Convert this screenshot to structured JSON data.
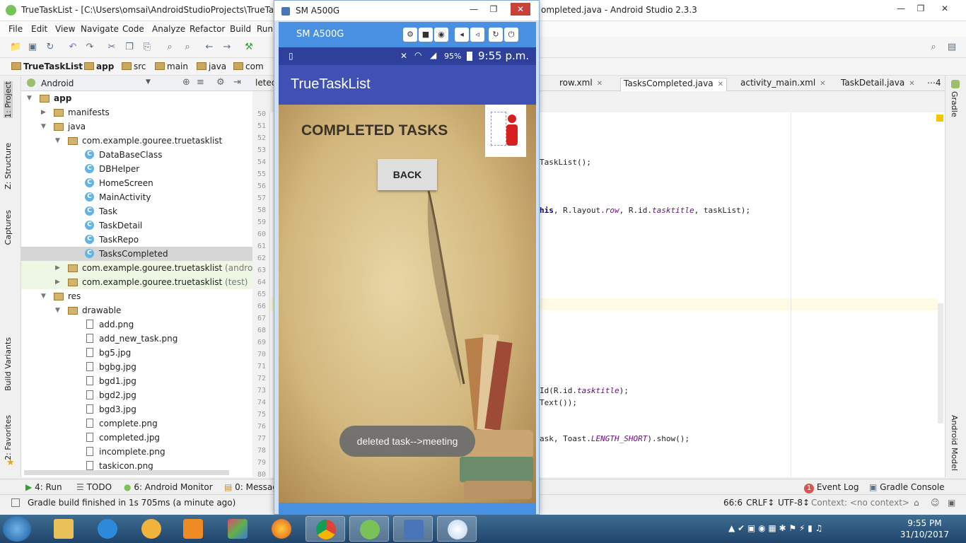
{
  "ide": {
    "title": "TrueTaskList - [C:\\Users\\omsai\\AndroidStudioProjects\\TrueTaskList]",
    "title_right": "ompleted.java - Android Studio 2.3.3",
    "menu": [
      "File",
      "Edit",
      "View",
      "Navigate",
      "Code",
      "Analyze",
      "Refactor",
      "Build",
      "Run"
    ],
    "breadcrumb": [
      "TrueTaskList",
      "app",
      "src",
      "main",
      "java",
      "com"
    ],
    "project_view": "Android",
    "left_tabs": [
      "1: Project",
      "Z: Structure",
      "Captures",
      "Build Variants",
      "2: Favorites"
    ],
    "right_tabs": [
      "Gradle",
      "Android Model"
    ],
    "tree": [
      {
        "label": "app",
        "depth": 0,
        "kind": "module",
        "open": true,
        "bold": true
      },
      {
        "label": "manifests",
        "depth": 1,
        "kind": "folder",
        "open": false
      },
      {
        "label": "java",
        "depth": 1,
        "kind": "folder",
        "open": true
      },
      {
        "label": "com.example.gouree.truetasklist",
        "depth": 2,
        "kind": "package",
        "open": true
      },
      {
        "label": "DataBaseClass",
        "depth": 3,
        "kind": "class"
      },
      {
        "label": "DBHelper",
        "depth": 3,
        "kind": "class"
      },
      {
        "label": "HomeScreen",
        "depth": 3,
        "kind": "class"
      },
      {
        "label": "MainActivity",
        "depth": 3,
        "kind": "class"
      },
      {
        "label": "Task",
        "depth": 3,
        "kind": "class"
      },
      {
        "label": "TaskDetail",
        "depth": 3,
        "kind": "class"
      },
      {
        "label": "TaskRepo",
        "depth": 3,
        "kind": "class"
      },
      {
        "label": "TasksCompleted",
        "depth": 3,
        "kind": "class",
        "selected": true
      },
      {
        "label": "com.example.gouree.truetasklist",
        "suffix": "(androidTest)",
        "depth": 2,
        "kind": "package",
        "open": false,
        "test": true
      },
      {
        "label": "com.example.gouree.truetasklist",
        "suffix": "(test)",
        "depth": 2,
        "kind": "package",
        "open": false,
        "test": true
      },
      {
        "label": "res",
        "depth": 1,
        "kind": "folder",
        "open": true
      },
      {
        "label": "drawable",
        "depth": 2,
        "kind": "folder",
        "open": true
      },
      {
        "label": "add.png",
        "depth": 3,
        "kind": "image"
      },
      {
        "label": "add_new_task.png",
        "depth": 3,
        "kind": "image"
      },
      {
        "label": "bg5.jpg",
        "depth": 3,
        "kind": "image"
      },
      {
        "label": "bgbg.jpg",
        "depth": 3,
        "kind": "image"
      },
      {
        "label": "bgd1.jpg",
        "depth": 3,
        "kind": "image"
      },
      {
        "label": "bgd2.jpg",
        "depth": 3,
        "kind": "image"
      },
      {
        "label": "bgd3.jpg",
        "depth": 3,
        "kind": "image"
      },
      {
        "label": "complete.png",
        "depth": 3,
        "kind": "image"
      },
      {
        "label": "completed.jpg",
        "depth": 3,
        "kind": "image"
      },
      {
        "label": "incomplete.png",
        "depth": 3,
        "kind": "image"
      },
      {
        "label": "taskicon.png",
        "depth": 3,
        "kind": "image"
      }
    ],
    "editor_tabs": [
      {
        "label": "leted.",
        "active": false
      },
      {
        "label": "row.xml",
        "active": false
      },
      {
        "label": "TasksCompleted.java",
        "active": true
      },
      {
        "label": "activity_main.xml",
        "active": false
      },
      {
        "label": "TaskDetail.java",
        "active": false
      },
      {
        "label": "⋯4",
        "active": false
      }
    ],
    "line_numbers": [
      "50",
      "51",
      "52",
      "53",
      "54",
      "55",
      "56",
      "57",
      "58",
      "59",
      "60",
      "61",
      "62",
      "63",
      "64",
      "65",
      "66",
      "67",
      "68",
      "69",
      "70",
      "71",
      "72",
      "73",
      "74",
      "75",
      "76",
      "77",
      "78",
      "79",
      "80"
    ],
    "code": [
      {
        "line": 54,
        "parts": [
          {
            "t": "TaskList();"
          }
        ]
      },
      {
        "line": 58,
        "parts": [
          {
            "t": "his",
            "cls": "code-b"
          },
          {
            "t": ", R.layout."
          },
          {
            "t": "row",
            "cls": "code-it"
          },
          {
            "t": ", R.id."
          },
          {
            "t": "tasktitle",
            "cls": "code-it"
          },
          {
            "t": ", taskList);"
          }
        ]
      },
      {
        "line": 73,
        "parts": [
          {
            "t": "Id(R.id."
          },
          {
            "t": "tasktitle",
            "cls": "code-it"
          },
          {
            "t": ");"
          }
        ]
      },
      {
        "line": 74,
        "parts": [
          {
            "t": "Text());"
          }
        ]
      },
      {
        "line": 77,
        "parts": [
          {
            "t": "ask, Toast."
          },
          {
            "t": "LENGTH_SHORT",
            "cls": "code-it"
          },
          {
            "t": ").show();"
          }
        ]
      }
    ],
    "bottom_tabs": [
      "4: Run",
      "TODO",
      "6: Android Monitor",
      "0: Messag"
    ],
    "bottom_right_tabs": {
      "event_log": "Event Log",
      "event_count": "1",
      "gradle_console": "Gradle Console"
    },
    "status": {
      "message": "Gradle build finished in 1s 705ms (a minute ago)",
      "position": "66:6",
      "line_sep": "CRLF↕",
      "encoding": "UTF-8↕",
      "context": "Context: <no context>"
    }
  },
  "emulator": {
    "window_title": "SM A500G",
    "device_label": "SM A500G",
    "controls": [
      "gear-icon",
      "video-icon",
      "camera-icon",
      "volume-down-icon",
      "volume-up-icon",
      "rotate-icon",
      "power-icon"
    ],
    "phone_status": {
      "battery": "95%",
      "time": "9:55 p.m."
    },
    "app_title": "TrueTaskList",
    "heading": "COMPLETED TASKS",
    "back_button": "BACK",
    "toast": "deleted task-->meeting"
  },
  "taskbar": {
    "apps": [
      "explorer",
      "internet-explorer",
      "favorites",
      "media-player",
      "paint-net",
      "firefox",
      "chrome",
      "android-studio",
      "emulator",
      "paint"
    ],
    "time": "9:55 PM",
    "date": "31/10/2017"
  }
}
